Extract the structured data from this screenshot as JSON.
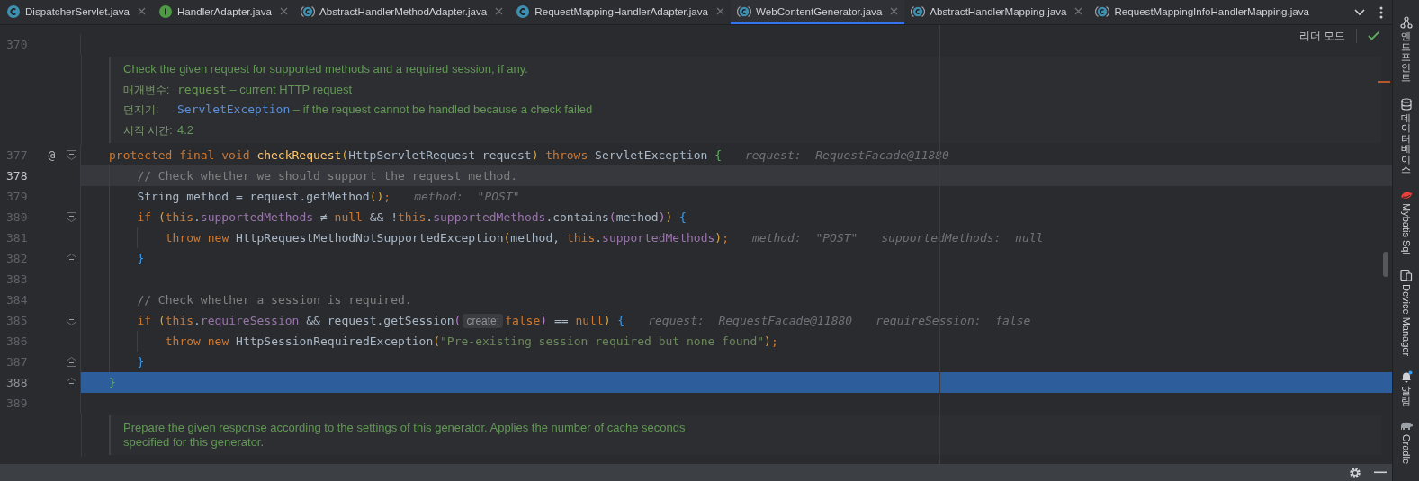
{
  "tabs": [
    {
      "label": "DispatcherServlet.java",
      "kind": "class",
      "selected": false,
      "closable": true
    },
    {
      "label": "HandlerAdapter.java",
      "kind": "interface",
      "selected": false,
      "closable": true
    },
    {
      "label": "AbstractHandlerMethodAdapter.java",
      "kind": "abstract",
      "selected": false,
      "closable": true
    },
    {
      "label": "RequestMappingHandlerAdapter.java",
      "kind": "class",
      "selected": false,
      "closable": true
    },
    {
      "label": "WebContentGenerator.java",
      "kind": "abstract",
      "selected": true,
      "closable": true
    },
    {
      "label": "AbstractHandlerMapping.java",
      "kind": "abstract",
      "selected": false,
      "closable": true
    },
    {
      "label": "RequestMappingInfoHandlerMapping.java",
      "kind": "abstract",
      "selected": false,
      "closable": false
    }
  ],
  "reader_mode": "리더 모드",
  "rows": [
    {
      "kind": "code",
      "number": "370",
      "fold_open": false,
      "fold_close": false,
      "current": false,
      "selected": false
    },
    {
      "kind": "doc",
      "lines": [
        {
          "text": "Check the given request for supported methods and a required session, if any."
        },
        {
          "label": "매개변수:",
          "code": "request",
          "text": " – current HTTP request"
        },
        {
          "label": "던지기:",
          "link": "ServletException",
          "text": " – if the request cannot be handled because a check failed"
        },
        {
          "label": "시작 시간:",
          "text": "4.2"
        }
      ]
    },
    {
      "kind": "code",
      "number": "377",
      "gutter_mark": "@",
      "fold_open": true,
      "fold_close": false,
      "current": false,
      "selected": false,
      "tokens": [
        {
          "kind": "keyword",
          "text": "protected final void "
        },
        {
          "kind": "method",
          "text": "checkRequest"
        },
        {
          "kind": "paren",
          "text": "("
        },
        {
          "kind": "plain",
          "text": "HttpServletRequest request"
        },
        {
          "kind": "paren",
          "text": ")"
        },
        {
          "kind": "keyword",
          "text": " throws "
        },
        {
          "kind": "plain",
          "text": "ServletException "
        },
        {
          "kind": "brace_green",
          "text": "{"
        }
      ],
      "hints": [
        "request:  RequestFacade@11880"
      ],
      "children": [
        {
          "kind": "code",
          "number": "378",
          "fold_open": false,
          "fold_close": false,
          "current": true,
          "selected": false,
          "tokens": [
            {
              "kind": "comment",
              "text": "// Check whether we should support the request method."
            }
          ]
        },
        {
          "kind": "code",
          "number": "379",
          "fold_open": false,
          "fold_close": false,
          "current": false,
          "selected": false,
          "tokens": [
            {
              "kind": "plain",
              "text": "String method = request.getMethod"
            },
            {
              "kind": "paren",
              "text": "()"
            },
            {
              "kind": "keyword",
              "text": ";"
            }
          ],
          "hints": [
            "method:  \"POST\""
          ]
        },
        {
          "kind": "code",
          "number": "380",
          "fold_open": true,
          "fold_close": false,
          "current": false,
          "selected": false,
          "tokens": [
            {
              "kind": "keyword",
              "text": "if "
            },
            {
              "kind": "paren",
              "text": "("
            },
            {
              "kind": "keyword",
              "text": "this"
            },
            {
              "kind": "plain",
              "text": "."
            },
            {
              "kind": "field",
              "text": "supportedMethods"
            },
            {
              "kind": "plain",
              "text": " ≠ "
            },
            {
              "kind": "keyword",
              "text": "null"
            },
            {
              "kind": "plain",
              "text": " && !"
            },
            {
              "kind": "keyword",
              "text": "this"
            },
            {
              "kind": "plain",
              "text": "."
            },
            {
              "kind": "field",
              "text": "supportedMethods"
            },
            {
              "kind": "plain",
              "text": ".contains"
            },
            {
              "kind": "paren_purple",
              "text": "("
            },
            {
              "kind": "plain",
              "text": "method"
            },
            {
              "kind": "paren_purple",
              "text": ")"
            },
            {
              "kind": "paren",
              "text": ")"
            },
            {
              "kind": "brace_blue",
              "text": " {"
            }
          ],
          "children": [
            {
              "kind": "code",
              "number": "381",
              "fold_open": false,
              "fold_close": false,
              "current": false,
              "selected": false,
              "tokens": [
                {
                  "kind": "keyword",
                  "text": "throw new "
                },
                {
                  "kind": "plain",
                  "text": "HttpRequestMethodNotSupportedException"
                },
                {
                  "kind": "paren",
                  "text": "("
                },
                {
                  "kind": "plain",
                  "text": "method, "
                },
                {
                  "kind": "keyword",
                  "text": "this"
                },
                {
                  "kind": "plain",
                  "text": "."
                },
                {
                  "kind": "field",
                  "text": "supportedMethods"
                },
                {
                  "kind": "paren",
                  "text": ")"
                },
                {
                  "kind": "keyword",
                  "text": ";"
                }
              ],
              "hints": [
                "method:  \"POST\"",
                "supportedMethods:  null"
              ]
            }
          ]
        },
        {
          "kind": "code",
          "number": "382",
          "fold_open": false,
          "fold_close": true,
          "current": false,
          "selected": false,
          "tokens": [
            {
              "kind": "brace_blue",
              "text": "}"
            }
          ]
        },
        {
          "kind": "code",
          "number": "383",
          "fold_open": false,
          "fold_close": false,
          "current": false,
          "selected": false
        },
        {
          "kind": "code",
          "number": "384",
          "fold_open": false,
          "fold_close": false,
          "current": false,
          "selected": false,
          "tokens": [
            {
              "kind": "comment",
              "text": "// Check whether a session is required."
            }
          ]
        },
        {
          "kind": "code",
          "number": "385",
          "fold_open": true,
          "fold_close": false,
          "current": false,
          "selected": false,
          "tokens": [
            {
              "kind": "keyword",
              "text": "if "
            },
            {
              "kind": "paren",
              "text": "("
            },
            {
              "kind": "keyword",
              "text": "this"
            },
            {
              "kind": "plain",
              "text": "."
            },
            {
              "kind": "field",
              "text": "requireSession"
            },
            {
              "kind": "plain",
              "text": " && request.getSession"
            },
            {
              "kind": "paren_purple",
              "text": "("
            },
            {
              "kind": "param_hint",
              "text": "create:"
            },
            {
              "kind": "keyword",
              "text": "false"
            },
            {
              "kind": "paren_purple",
              "text": ")"
            },
            {
              "kind": "plain",
              "text": " == "
            },
            {
              "kind": "keyword",
              "text": "null"
            },
            {
              "kind": "paren",
              "text": ")"
            },
            {
              "kind": "brace_blue",
              "text": " {"
            }
          ],
          "hints": [
            "request:  RequestFacade@11880",
            "requireSession:  false"
          ],
          "children": [
            {
              "kind": "code",
              "number": "386",
              "fold_open": false,
              "fold_close": false,
              "current": false,
              "selected": false,
              "tokens": [
                {
                  "kind": "keyword",
                  "text": "throw new "
                },
                {
                  "kind": "plain",
                  "text": "HttpSessionRequiredException"
                },
                {
                  "kind": "paren",
                  "text": "("
                },
                {
                  "kind": "string",
                  "text": "\"Pre-existing session required but none found\""
                },
                {
                  "kind": "paren",
                  "text": ")"
                },
                {
                  "kind": "keyword",
                  "text": ";"
                }
              ]
            }
          ]
        },
        {
          "kind": "code",
          "number": "387",
          "fold_open": false,
          "fold_close": true,
          "current": false,
          "selected": false,
          "tokens": [
            {
              "kind": "brace_blue",
              "text": "}"
            }
          ]
        }
      ]
    },
    {
      "kind": "code",
      "number": "388",
      "fold_open": false,
      "fold_close": true,
      "current": false,
      "selected": true,
      "tokens": [
        {
          "kind": "brace_green",
          "text": "}"
        }
      ]
    },
    {
      "kind": "code",
      "number": "389",
      "fold_open": false,
      "fold_close": false,
      "current": false,
      "selected": false
    },
    {
      "kind": "doc",
      "lines": [
        {
          "text": "Prepare the given response according to the settings of this generator. Applies the number of cache seconds specified for this generator."
        }
      ]
    }
  ],
  "tool_strip": [
    {
      "label": "엔드포인트",
      "kind": "endpoints",
      "rotated": false
    },
    {
      "label": "데이터베이스",
      "kind": "database",
      "rotated": false
    },
    {
      "label": "Mybatis Sql",
      "kind": "bird",
      "rotated": true
    },
    {
      "label": "Device Manager",
      "kind": "device",
      "rotated": true
    },
    {
      "label": "알림",
      "kind": "bell",
      "rotated": false
    },
    {
      "label": "Gradle",
      "kind": "elephant",
      "rotated": true
    }
  ]
}
